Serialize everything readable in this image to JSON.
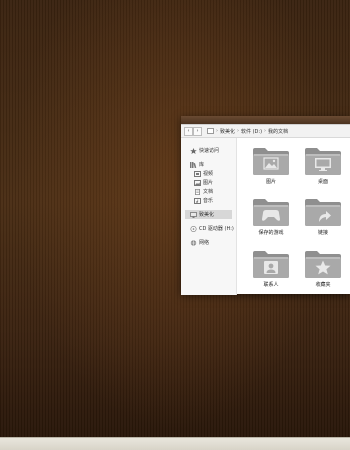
{
  "window": {
    "nav_back": "‹",
    "nav_forward": "›",
    "breadcrumb": [
      "致美化",
      "软件 (D:)",
      "我的文档"
    ],
    "breadcrumb_sep": "›"
  },
  "sidebar": {
    "items": [
      {
        "label": "快速访问",
        "icon": "star-icon"
      },
      {
        "label": "库",
        "icon": "library-icon"
      },
      {
        "label": "视频",
        "icon": "video-icon"
      },
      {
        "label": "图片",
        "icon": "image-icon"
      },
      {
        "label": "文档",
        "icon": "document-icon"
      },
      {
        "label": "音乐",
        "icon": "music-icon"
      },
      {
        "label": "致美化",
        "icon": "computer-icon",
        "selected": true
      },
      {
        "label": "CD 驱动器 (H:)",
        "icon": "cd-drive-icon"
      },
      {
        "label": "网络",
        "icon": "network-icon"
      }
    ]
  },
  "folders": [
    {
      "label": "图片",
      "icon": "picture-icon"
    },
    {
      "label": "桌面",
      "icon": "desktop-icon"
    },
    {
      "label": "保存的游戏",
      "icon": "gamepad-icon"
    },
    {
      "label": "链接",
      "icon": "link-arrow-icon"
    },
    {
      "label": "联系人",
      "icon": "contact-icon"
    },
    {
      "label": "收藏夹",
      "icon": "star-icon"
    }
  ],
  "colors": {
    "wallpaper": "#3e2612",
    "folder": "#9a9a9a",
    "selected": "#d7d7d7"
  }
}
